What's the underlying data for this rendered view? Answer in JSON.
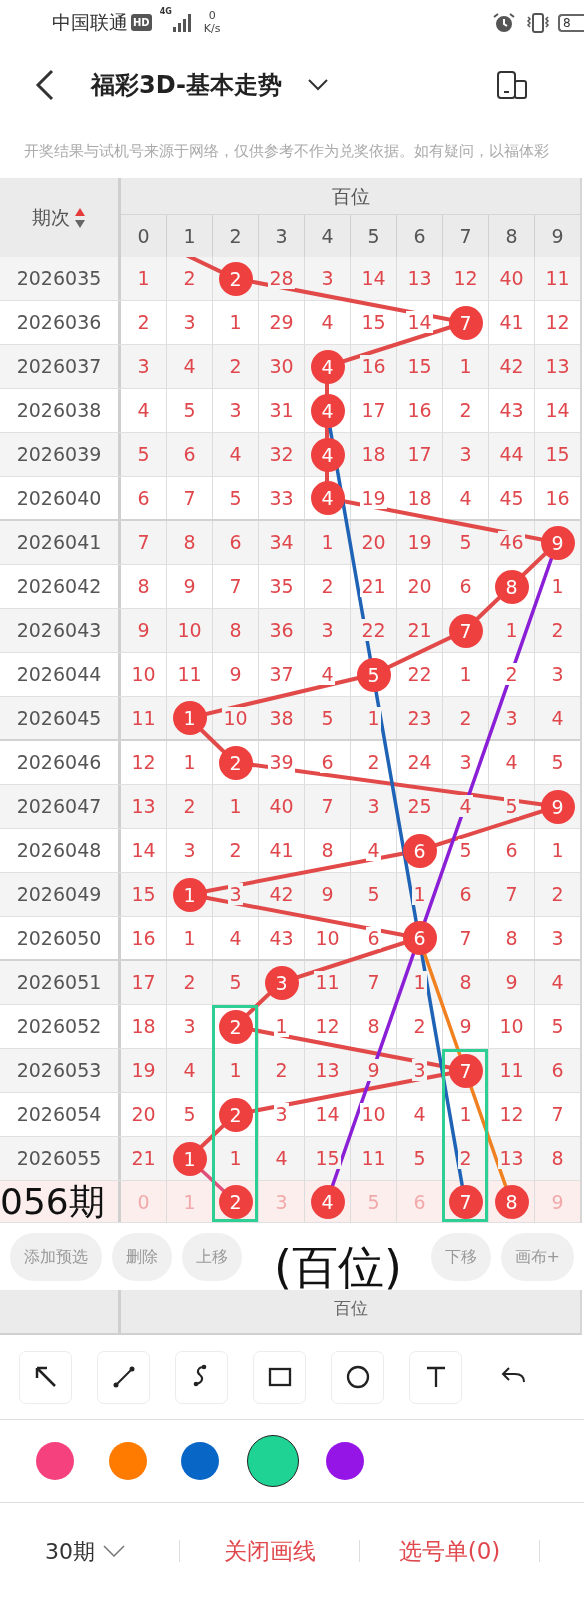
{
  "status_bar": {
    "carrier": "中国联通",
    "hd": "HD",
    "network": "4G",
    "speed_value": "0",
    "speed_unit": "K/s",
    "battery": "8"
  },
  "header": {
    "title": "福彩3D-基本走势"
  },
  "notice": "开奖结果与试机号来源于网络，仅供参考不作为兑奖依据。如有疑问，以福体彩",
  "table": {
    "corner": "期次",
    "group": "百位",
    "columns": [
      "0",
      "1",
      "2",
      "3",
      "4",
      "5",
      "6",
      "7",
      "8",
      "9"
    ],
    "rows": [
      {
        "period": "2026035",
        "cells": [
          "1",
          "2",
          "2",
          "28",
          "3",
          "14",
          "13",
          "12",
          "40",
          "11"
        ],
        "hit": [
          false,
          false,
          true,
          false,
          false,
          false,
          false,
          false,
          false,
          false
        ]
      },
      {
        "period": "2026036",
        "cells": [
          "2",
          "3",
          "1",
          "29",
          "4",
          "15",
          "14",
          "7",
          "41",
          "12"
        ],
        "hit": [
          false,
          false,
          false,
          false,
          false,
          false,
          false,
          true,
          false,
          false
        ]
      },
      {
        "period": "2026037",
        "cells": [
          "3",
          "4",
          "2",
          "30",
          "4",
          "16",
          "15",
          "1",
          "42",
          "13"
        ],
        "hit": [
          false,
          false,
          false,
          false,
          true,
          false,
          false,
          false,
          false,
          false
        ]
      },
      {
        "period": "2026038",
        "cells": [
          "4",
          "5",
          "3",
          "31",
          "4",
          "17",
          "16",
          "2",
          "43",
          "14"
        ],
        "hit": [
          false,
          false,
          false,
          false,
          true,
          false,
          false,
          false,
          false,
          false
        ]
      },
      {
        "period": "2026039",
        "cells": [
          "5",
          "6",
          "4",
          "32",
          "4",
          "18",
          "17",
          "3",
          "44",
          "15"
        ],
        "hit": [
          false,
          false,
          false,
          false,
          true,
          false,
          false,
          false,
          false,
          false
        ]
      },
      {
        "period": "2026040",
        "cells": [
          "6",
          "7",
          "5",
          "33",
          "4",
          "19",
          "18",
          "4",
          "45",
          "16"
        ],
        "hit": [
          false,
          false,
          false,
          false,
          true,
          false,
          false,
          false,
          false,
          false
        ]
      },
      {
        "period": "2026041",
        "cells": [
          "7",
          "8",
          "6",
          "34",
          "1",
          "20",
          "19",
          "5",
          "46",
          "9"
        ],
        "hit": [
          false,
          false,
          false,
          false,
          false,
          false,
          false,
          false,
          false,
          true
        ]
      },
      {
        "period": "2026042",
        "cells": [
          "8",
          "9",
          "7",
          "35",
          "2",
          "21",
          "20",
          "6",
          "8",
          "1"
        ],
        "hit": [
          false,
          false,
          false,
          false,
          false,
          false,
          false,
          false,
          true,
          false
        ]
      },
      {
        "period": "2026043",
        "cells": [
          "9",
          "10",
          "8",
          "36",
          "3",
          "22",
          "21",
          "7",
          "1",
          "2"
        ],
        "hit": [
          false,
          false,
          false,
          false,
          false,
          false,
          false,
          true,
          false,
          false
        ]
      },
      {
        "period": "2026044",
        "cells": [
          "10",
          "11",
          "9",
          "37",
          "4",
          "5",
          "22",
          "1",
          "2",
          "3"
        ],
        "hit": [
          false,
          false,
          false,
          false,
          false,
          true,
          false,
          false,
          false,
          false
        ]
      },
      {
        "period": "2026045",
        "cells": [
          "11",
          "1",
          "10",
          "38",
          "5",
          "1",
          "23",
          "2",
          "3",
          "4"
        ],
        "hit": [
          false,
          true,
          false,
          false,
          false,
          false,
          false,
          false,
          false,
          false
        ]
      },
      {
        "period": "2026046",
        "cells": [
          "12",
          "1",
          "2",
          "39",
          "6",
          "2",
          "24",
          "3",
          "4",
          "5"
        ],
        "hit": [
          false,
          false,
          true,
          false,
          false,
          false,
          false,
          false,
          false,
          false
        ]
      },
      {
        "period": "2026047",
        "cells": [
          "13",
          "2",
          "1",
          "40",
          "7",
          "3",
          "25",
          "4",
          "5",
          "9"
        ],
        "hit": [
          false,
          false,
          false,
          false,
          false,
          false,
          false,
          false,
          false,
          true
        ]
      },
      {
        "period": "2026048",
        "cells": [
          "14",
          "3",
          "2",
          "41",
          "8",
          "4",
          "6",
          "5",
          "6",
          "1"
        ],
        "hit": [
          false,
          false,
          false,
          false,
          false,
          false,
          true,
          false,
          false,
          false
        ]
      },
      {
        "period": "2026049",
        "cells": [
          "15",
          "1",
          "3",
          "42",
          "9",
          "5",
          "1",
          "6",
          "7",
          "2"
        ],
        "hit": [
          false,
          true,
          false,
          false,
          false,
          false,
          false,
          false,
          false,
          false
        ]
      },
      {
        "period": "2026050",
        "cells": [
          "16",
          "1",
          "4",
          "43",
          "10",
          "6",
          "6",
          "7",
          "8",
          "3"
        ],
        "hit": [
          false,
          false,
          false,
          false,
          false,
          false,
          true,
          false,
          false,
          false
        ]
      },
      {
        "period": "2026051",
        "cells": [
          "17",
          "2",
          "5",
          "3",
          "11",
          "7",
          "1",
          "8",
          "9",
          "4"
        ],
        "hit": [
          false,
          false,
          false,
          true,
          false,
          false,
          false,
          false,
          false,
          false
        ]
      },
      {
        "period": "2026052",
        "cells": [
          "18",
          "3",
          "2",
          "1",
          "12",
          "8",
          "2",
          "9",
          "10",
          "5"
        ],
        "hit": [
          false,
          false,
          true,
          false,
          false,
          false,
          false,
          false,
          false,
          false
        ]
      },
      {
        "period": "2026053",
        "cells": [
          "19",
          "4",
          "1",
          "2",
          "13",
          "9",
          "3",
          "7",
          "11",
          "6"
        ],
        "hit": [
          false,
          false,
          false,
          false,
          false,
          false,
          false,
          true,
          false,
          false
        ]
      },
      {
        "period": "2026054",
        "cells": [
          "20",
          "5",
          "2",
          "3",
          "14",
          "10",
          "4",
          "1",
          "12",
          "7"
        ],
        "hit": [
          false,
          false,
          true,
          false,
          false,
          false,
          false,
          false,
          false,
          false
        ]
      },
      {
        "period": "2026055",
        "cells": [
          "21",
          "1",
          "1",
          "4",
          "15",
          "11",
          "5",
          "2",
          "13",
          "8"
        ],
        "hit": [
          false,
          true,
          false,
          false,
          false,
          false,
          false,
          false,
          false,
          false
        ]
      }
    ],
    "prediction": [
      {
        "text": "0",
        "selected": false
      },
      {
        "text": "1",
        "selected": false
      },
      {
        "text": "2",
        "selected": true
      },
      {
        "text": "3",
        "selected": false
      },
      {
        "text": "4",
        "selected": true
      },
      {
        "text": "5",
        "selected": false
      },
      {
        "text": "6",
        "selected": false
      },
      {
        "text": "7",
        "selected": true
      },
      {
        "text": "8",
        "selected": true
      },
      {
        "text": "9",
        "selected": false
      }
    ],
    "footer_group": "百位"
  },
  "annotations": [
    {
      "kind": "text",
      "text": "056期"
    },
    {
      "kind": "text",
      "text": "(百位)"
    },
    {
      "kind": "line",
      "color": "#1e63b5"
    },
    {
      "kind": "line",
      "color": "#8a1fd6"
    },
    {
      "kind": "line",
      "color": "#f08020"
    },
    {
      "kind": "line",
      "color": "#e0507a"
    },
    {
      "kind": "rect",
      "color": "#2ecf95"
    },
    {
      "kind": "rect",
      "color": "#2ecf95"
    }
  ],
  "actions": [
    "添加预选",
    "删除",
    "上移",
    "下移",
    "画布+"
  ],
  "tools": [
    {
      "kind": "arrow"
    },
    {
      "kind": "line"
    },
    {
      "kind": "curve"
    },
    {
      "kind": "rect"
    },
    {
      "kind": "ellipse"
    },
    {
      "kind": "text"
    },
    {
      "kind": "undo"
    }
  ],
  "palette": [
    {
      "color": "#f5427f",
      "selected": false
    },
    {
      "color": "#ff7b00",
      "selected": false
    },
    {
      "color": "#0866c6",
      "selected": false
    },
    {
      "color": "#1ed394",
      "selected": true
    },
    {
      "color": "#9514e6",
      "selected": false
    }
  ],
  "bottom_bar": {
    "period_select": "30期",
    "items": [
      "关闭画线",
      "选号单(0)"
    ]
  }
}
